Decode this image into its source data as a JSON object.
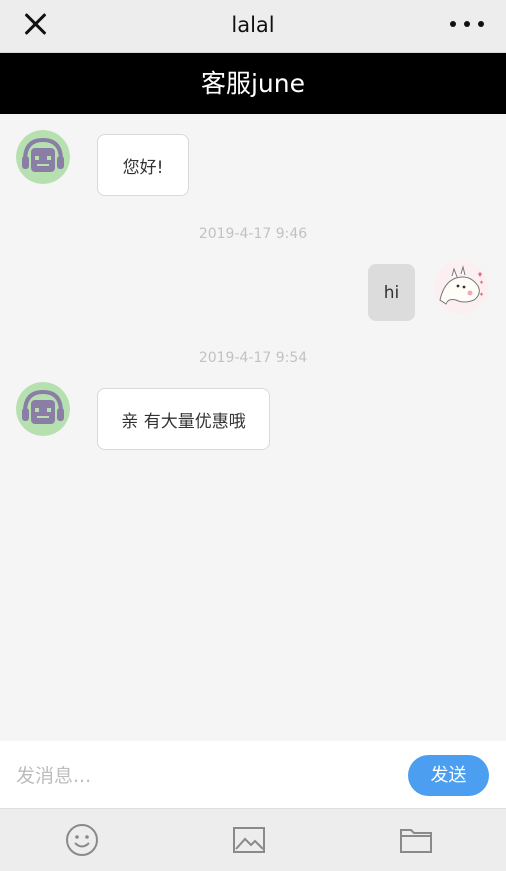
{
  "topbar": {
    "title": "lalal"
  },
  "chat": {
    "header_title": "客服june",
    "messages": [
      {
        "side": "left",
        "text": "您好!"
      },
      {
        "timestamp": "2019-4-17 9:46"
      },
      {
        "side": "right",
        "text": "hi"
      },
      {
        "timestamp": "2019-4-17 9:54"
      },
      {
        "side": "left",
        "text": "亲 有大量优惠哦"
      }
    ]
  },
  "input": {
    "placeholder": "发消息...",
    "value": "",
    "send_label": "发送"
  },
  "toolbar": {
    "items": [
      "emoji-icon",
      "image-icon",
      "folder-icon"
    ]
  },
  "colors": {
    "send_button": "#4c9ff0",
    "header_bg": "#000000",
    "agent_avatar_bg": "#b7e0b0",
    "agent_avatar_face": "#8a7ea6"
  }
}
